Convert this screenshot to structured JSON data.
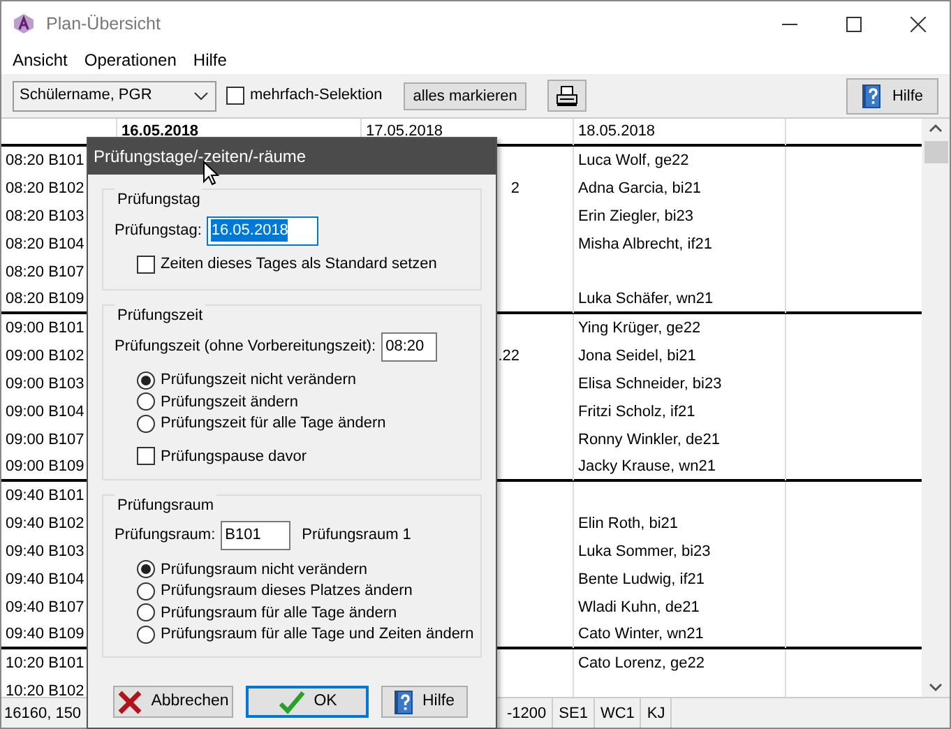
{
  "window": {
    "title": "Plan-Übersicht"
  },
  "menu": [
    {
      "label": "Ansicht"
    },
    {
      "label": "Operationen"
    },
    {
      "label": "Hilfe"
    }
  ],
  "toolbar": {
    "sort_select": {
      "value": "Schülername, PGR"
    },
    "multi_select": {
      "label": "mehrfach-Selektion",
      "checked": false
    },
    "mark_all_button": {
      "label": "alles markieren"
    },
    "help_button": {
      "label": "Hilfe"
    }
  },
  "grid": {
    "columns": [
      {
        "label": "16.05.2018",
        "selected": true
      },
      {
        "label": "17.05.2018",
        "selected": false
      },
      {
        "label": "18.05.2018",
        "selected": false
      }
    ],
    "rows": [
      {
        "slot": "08:20 B101",
        "day_3": "Luca Wolf, ge22"
      },
      {
        "slot": "08:20 B102",
        "day_2": "2",
        "day_3": "Adna Garcia, bi21"
      },
      {
        "slot": "08:20 B103",
        "day_3": "Erin Ziegler, bi23"
      },
      {
        "slot": "08:20 B104",
        "day_3": "Misha Albrecht, if21"
      },
      {
        "slot": "08:20 B107"
      },
      {
        "slot": "08:20 B109",
        "day_3": "Luka Schäfer, wn21"
      },
      {
        "slot": "09:00 B101",
        "day_3": "Ying Krüger, ge22"
      },
      {
        "slot": "09:00 B102",
        "day_2": ".22",
        "day_3": "Jona Seidel, bi21"
      },
      {
        "slot": "09:00 B103",
        "day_3": "Elisa Schneider, bi23"
      },
      {
        "slot": "09:00 B104",
        "day_3": "Fritzi Scholz, if21"
      },
      {
        "slot": "09:00 B107",
        "day_3": "Ronny Winkler, de21"
      },
      {
        "slot": "09:00 B109",
        "day_3": "Jacky Krause, wn21"
      },
      {
        "slot": "09:40 B101"
      },
      {
        "slot": "09:40 B102",
        "day_3": "Elin Roth, bi21"
      },
      {
        "slot": "09:40 B103",
        "day_3": "Luka Sommer, bi23"
      },
      {
        "slot": "09:40 B104",
        "day_3": "Bente Ludwig, if21"
      },
      {
        "slot": "09:40 B107",
        "day_3": "Wladi Kuhn, de21"
      },
      {
        "slot": "09:40 B109",
        "day_3": "Cato Winter, wn21"
      },
      {
        "slot": "10:20 B101",
        "day_3": "Cato Lorenz, ge22"
      },
      {
        "slot": "10:20 B102"
      }
    ]
  },
  "status_bar": [
    "16160, 150",
    "-1200",
    "SE1",
    "WC1",
    "KJ"
  ],
  "dialog": {
    "title": "Prüfungstage/-zeiten/-räume",
    "groups": [
      {
        "title": "Prüfungstag",
        "field": {
          "label": "Prüfungstag:",
          "value": "16.05.2018",
          "selected": true
        },
        "options": [
          {
            "kind": "checkbox",
            "label": "Zeiten dieses Tages als Standard setzen",
            "checked": false
          }
        ]
      },
      {
        "title": "Prüfungszeit",
        "field": {
          "label": "Prüfungszeit (ohne Vorbereitungszeit):",
          "value": "08:20",
          "selected": false
        },
        "options": [
          {
            "kind": "radio",
            "label": "Prüfungszeit nicht verändern",
            "selected": true
          },
          {
            "kind": "radio",
            "label": "Prüfungszeit ändern",
            "selected": false
          },
          {
            "kind": "radio",
            "label": "Prüfungszeit für alle Tage ändern",
            "selected": false
          },
          {
            "kind": "checkbox",
            "label": "Prüfungspause davor",
            "checked": false
          }
        ]
      },
      {
        "title": "Prüfungsraum",
        "field": {
          "label": "Prüfungsraum:",
          "value": "B101",
          "note": "Prüfungsraum 1",
          "selected": false
        },
        "options": [
          {
            "kind": "radio",
            "label": "Prüfungsraum nicht verändern",
            "selected": true
          },
          {
            "kind": "radio",
            "label": "Prüfungsraum dieses Platzes ändern",
            "selected": false
          },
          {
            "kind": "radio",
            "label": "Prüfungsraum für alle Tage ändern",
            "selected": false
          },
          {
            "kind": "radio",
            "label": "Prüfungsraum für alle Tage und Zeiten ändern",
            "selected": false
          }
        ]
      }
    ],
    "buttons": [
      {
        "kind": "cancel",
        "label": "Abbrechen",
        "default": false
      },
      {
        "kind": "ok",
        "label": "OK",
        "default": true
      },
      {
        "kind": "help",
        "label": "Hilfe",
        "default": false
      }
    ]
  }
}
